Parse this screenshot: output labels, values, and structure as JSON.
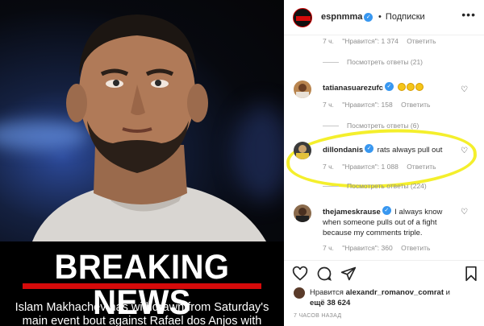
{
  "post": {
    "headline": "BREAKING NEWS",
    "caption_line1": "Islam Makhachev has withdrawn from Saturday's",
    "caption_line2": "main event bout against Rafael dos Anjos with"
  },
  "header": {
    "username": "espnmma",
    "separator": "•",
    "follow_label": "Подписки",
    "more_icon": "more-horizontal-icon"
  },
  "comments": [
    {
      "partial_meta": {
        "time": "7 ч.",
        "likes": "\"Нравится\": 1 374",
        "reply": "Ответить"
      },
      "replies_label": "Посмотреть ответы (21)"
    },
    {
      "user": "tatianasuarezufc",
      "text": "",
      "emoji_count": 3,
      "time": "7 ч.",
      "likes": "\"Нравится\": 158",
      "reply": "Ответить",
      "replies_label": "Посмотреть ответы (6)"
    },
    {
      "user": "dillondanis",
      "text": "rats always pull out",
      "time": "7 ч.",
      "likes": "\"Нравится\": 1 088",
      "reply": "Ответить",
      "replies_label": "Посмотреть ответы (224)"
    },
    {
      "user": "thejameskrause",
      "text_line1": "I always know",
      "text_line2": "when someone pulls out of a fight",
      "text_line3": "because my comments triple.",
      "time": "7 ч.",
      "likes": "\"Нравится\": 360",
      "reply": "Ответить"
    }
  ],
  "footer": {
    "likes_prefix": "Нравится",
    "likes_user": "alexandr_romanov_comrat",
    "likes_and": "и",
    "likes_more": "ещё 38 624",
    "time_ago": "7 ЧАСОВ НАЗАД"
  },
  "colors": {
    "highlight": "#f4ef2c",
    "verified": "#3897f0",
    "espn_red": "#d50a0a"
  }
}
